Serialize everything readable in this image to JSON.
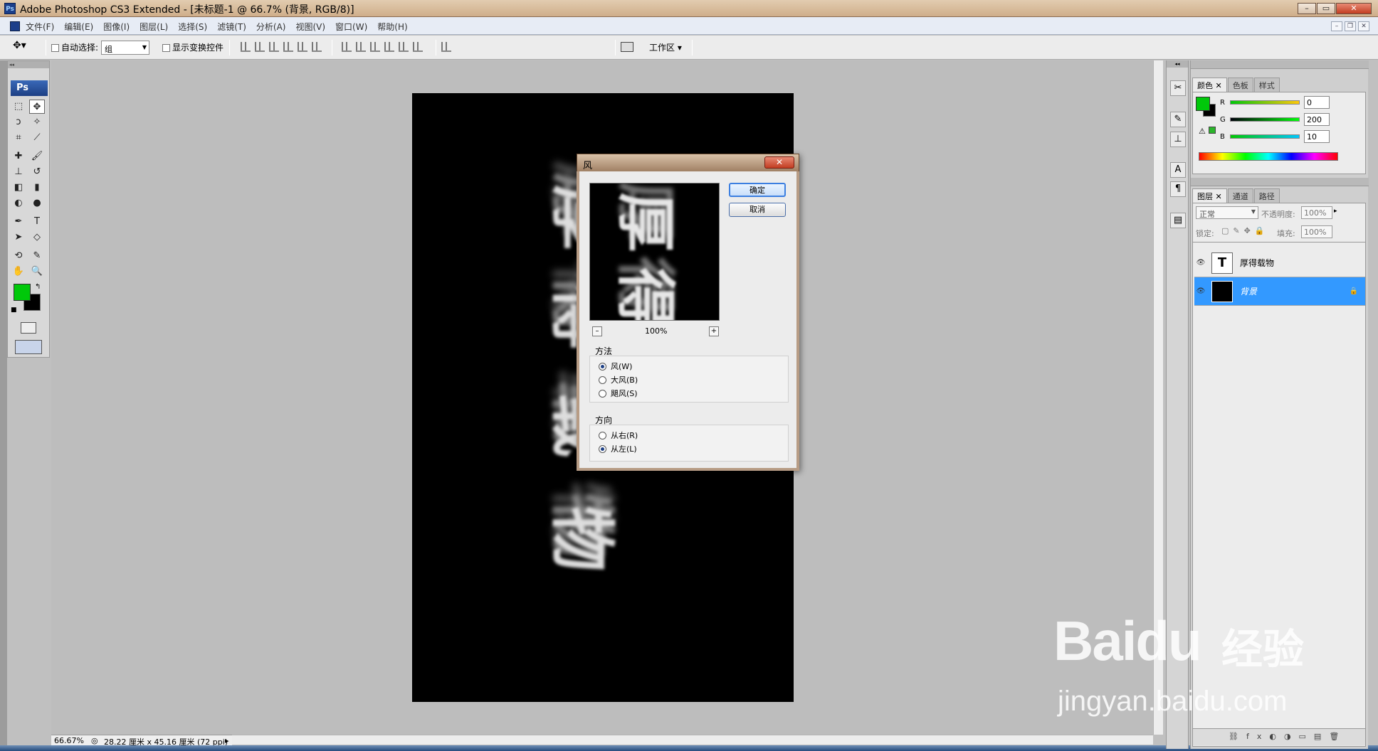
{
  "app": {
    "title": "Adobe Photoshop CS3 Extended - [未标题-1 @ 66.7% (背景, RGB/8)]",
    "menu": [
      "文件(F)",
      "编辑(E)",
      "图像(I)",
      "图层(L)",
      "选择(S)",
      "滤镜(T)",
      "分析(A)",
      "视图(V)",
      "窗口(W)",
      "帮助(H)"
    ]
  },
  "options": {
    "auto_select_label": "自动选择:",
    "auto_select_value": "组",
    "show_transform_label": "显示变换控件",
    "workspace_label": "工作区"
  },
  "status": {
    "zoom": "66.67%",
    "doc_info": "28.22 厘米 x 45.16 厘米 (72 ppi)"
  },
  "color_panel": {
    "tabs": [
      "颜色",
      "色板",
      "样式"
    ],
    "channels": [
      {
        "name": "R",
        "value": "0"
      },
      {
        "name": "G",
        "value": "200"
      },
      {
        "name": "B",
        "value": "10"
      }
    ],
    "foreground": "#00c80a",
    "background": "#000000"
  },
  "layers_panel": {
    "tabs": [
      "图层",
      "通道",
      "路径"
    ],
    "blend_mode": "正常",
    "opacity_label": "不透明度:",
    "opacity_value": "100%",
    "lock_label": "锁定:",
    "fill_label": "填充:",
    "fill_value": "100%",
    "layers": [
      {
        "name": "厚得载物",
        "thumb": "T",
        "selected": false
      },
      {
        "name": "背景",
        "thumb": "",
        "selected": true
      }
    ]
  },
  "dialog": {
    "title": "风",
    "ok": "确定",
    "cancel": "取消",
    "zoom": "100%",
    "method_label": "方法",
    "methods": [
      "风(W)",
      "大风(B)",
      "飓风(S)"
    ],
    "method_selected": 0,
    "direction_label": "方向",
    "directions": [
      "从右(R)",
      "从左(L)"
    ],
    "direction_selected": 1
  },
  "watermark": {
    "brand": "Baidu",
    "suffix": "经验",
    "url": "jingyan.baidu.com"
  },
  "colors": {
    "selection": "#3399ff",
    "foreground_swatch": "#00c80a"
  }
}
